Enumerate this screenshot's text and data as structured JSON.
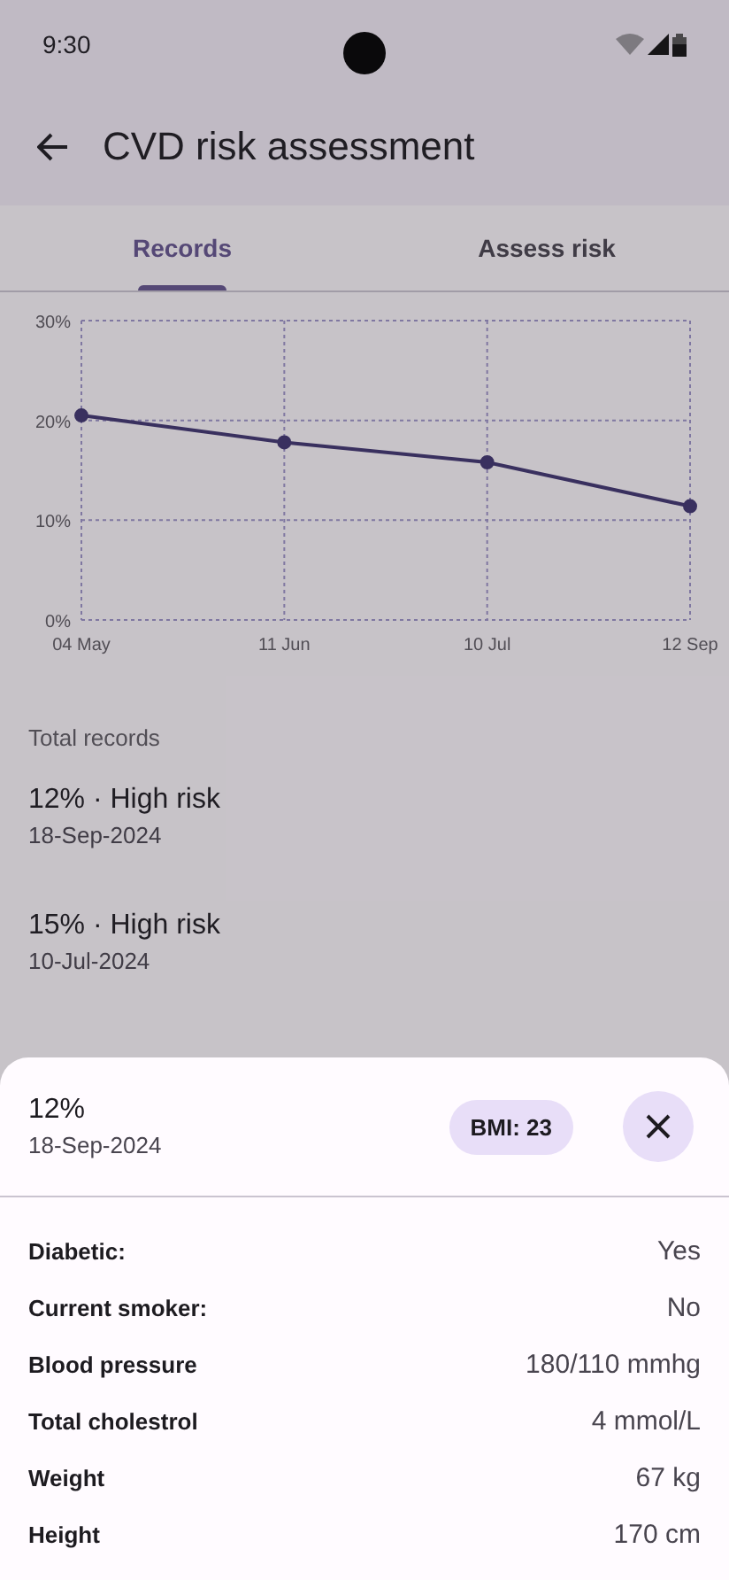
{
  "status_bar": {
    "time": "9:30"
  },
  "app_bar": {
    "title": "CVD risk assessment"
  },
  "tabs": [
    {
      "label": "Records",
      "selected": true
    },
    {
      "label": "Assess risk",
      "selected": false
    }
  ],
  "chart_data": {
    "type": "line",
    "categories": [
      "04 May",
      "11 Jun",
      "10 Jul",
      "12 Sep"
    ],
    "ylim": [
      0,
      30
    ],
    "yticks": [
      {
        "value": 0,
        "label": "0%"
      },
      {
        "value": 10,
        "label": "10%"
      },
      {
        "value": 20,
        "label": "20%"
      },
      {
        "value": 30,
        "label": "30%"
      }
    ],
    "grid": true,
    "series": [
      {
        "color": "#3f3470",
        "marker": "circle",
        "values": [
          20.5,
          17.8,
          15.8,
          11.4
        ]
      }
    ]
  },
  "records_heading": "Total records",
  "records": [
    {
      "title": "12% · High risk",
      "date": "18-Sep-2024"
    },
    {
      "title": "15% · High risk",
      "date": "10-Jul-2024"
    }
  ],
  "sheet": {
    "score": "12%",
    "date": "18-Sep-2024",
    "bmi": "BMI: 23",
    "details": [
      {
        "label": "Diabetic:",
        "value": "Yes"
      },
      {
        "label": "Current smoker:",
        "value": "No"
      },
      {
        "label": "Blood pressure",
        "value": "180/110 mmhg"
      },
      {
        "label": "Total cholestrol",
        "value": "4 mmol/L"
      },
      {
        "label": "Weight",
        "value": "67 kg"
      },
      {
        "label": "Height",
        "value": "170 cm"
      }
    ]
  }
}
